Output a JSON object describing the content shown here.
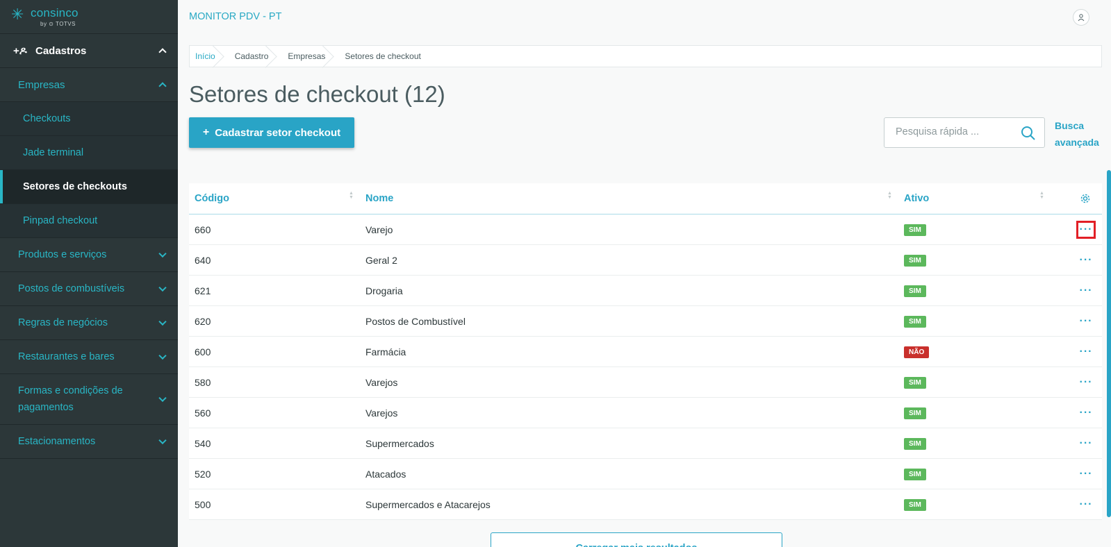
{
  "logo": {
    "name": "consinco",
    "by": "by ⊙ TOTVS"
  },
  "sidebar": {
    "top": {
      "label": "Cadastros"
    },
    "sub": {
      "label": "Empresas"
    },
    "leaves": [
      {
        "label": "Checkouts"
      },
      {
        "label": "Jade terminal"
      },
      {
        "label": "Setores de checkouts",
        "active": true
      },
      {
        "label": "Pinpad checkout"
      }
    ],
    "sections": [
      {
        "label": "Produtos e serviços"
      },
      {
        "label": "Postos de combustíveis"
      },
      {
        "label": "Regras de negócios"
      },
      {
        "label": "Restaurantes e bares"
      },
      {
        "label": "Formas e condições de pagamentos"
      },
      {
        "label": "Estacionamentos"
      }
    ]
  },
  "header": {
    "app_title": "MONITOR PDV - PT"
  },
  "breadcrumb": [
    "Início",
    "Cadastro",
    "Empresas",
    "Setores de checkout"
  ],
  "page": {
    "title": "Setores de checkout (12)",
    "add_button": "Cadastrar setor checkout",
    "search_placeholder": "Pesquisa rápida ...",
    "advanced_search": "Busca avançada",
    "load_more": "Carregar mais resultados"
  },
  "table": {
    "columns": [
      "Código",
      "Nome",
      "Ativo"
    ],
    "rows": [
      {
        "code": "660",
        "name": "Varejo",
        "active": "SIM"
      },
      {
        "code": "640",
        "name": "Geral 2",
        "active": "SIM"
      },
      {
        "code": "621",
        "name": "Drogaria",
        "active": "SIM"
      },
      {
        "code": "620",
        "name": "Postos de Combustível",
        "active": "SIM"
      },
      {
        "code": "600",
        "name": "Farmácia",
        "active": "NÃO"
      },
      {
        "code": "580",
        "name": "Varejos",
        "active": "SIM"
      },
      {
        "code": "560",
        "name": "Varejos",
        "active": "SIM"
      },
      {
        "code": "540",
        "name": "Supermercados",
        "active": "SIM"
      },
      {
        "code": "520",
        "name": "Atacados",
        "active": "SIM"
      },
      {
        "code": "500",
        "name": "Supermercados e Atacarejos",
        "active": "SIM"
      }
    ]
  },
  "colors": {
    "accent": "#29a4c6",
    "sidebar": "#2c3739",
    "yes": "#5cb85c",
    "no": "#c9302c",
    "highlight": "#e21f26"
  }
}
